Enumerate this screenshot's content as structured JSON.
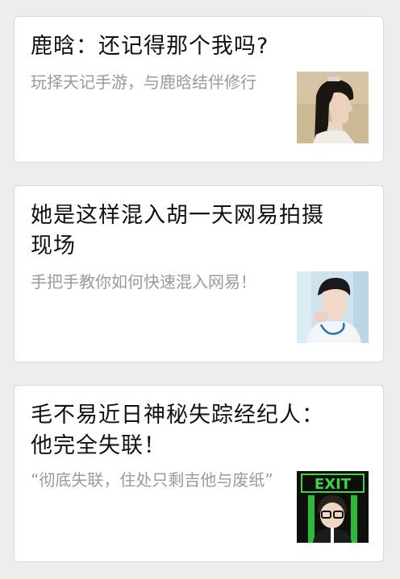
{
  "articles": [
    {
      "title": "鹿晗：还记得那个我吗?",
      "summary": "玩择天记手游，与鹿晗结伴修行",
      "thumbnail_icon": "costume-portrait-thumbnail"
    },
    {
      "title": "她是这样混入胡一天网易拍摄现场",
      "summary": "手把手教你如何快速混入网易！",
      "thumbnail_icon": "actor-portrait-thumbnail"
    },
    {
      "title": "毛不易近日神秘失踪经纪人：他完全失联！",
      "summary": "“彻底失联，住处只剩吉他与废纸”",
      "thumbnail_icon": "exit-sign-portrait-thumbnail",
      "thumbnail_text": "EXIT"
    }
  ]
}
